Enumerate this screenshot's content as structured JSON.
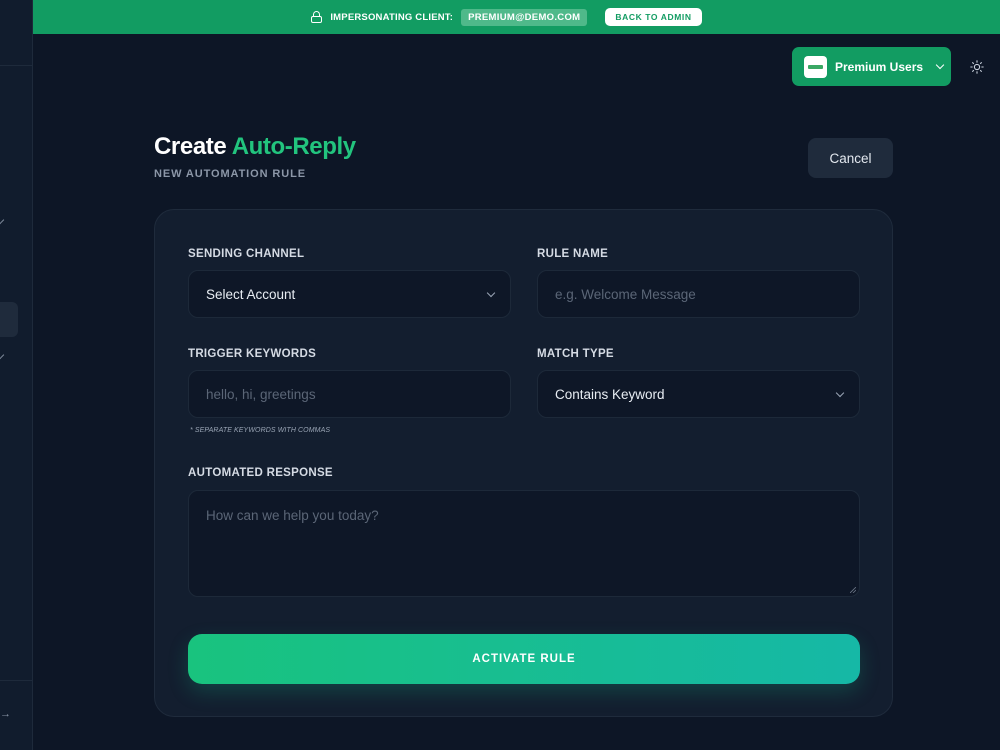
{
  "banner": {
    "label": "IMPERSONATING CLIENT:",
    "email": "PREMIUM@DEMO.COM",
    "back_label": "BACK TO ADMIN"
  },
  "account": {
    "name": "Premium Users",
    "logo": "brand-logo-icon"
  },
  "header": {
    "title_part1": "Create",
    "title_part2": "Auto-Reply",
    "subtitle": "NEW AUTOMATION RULE",
    "cancel_label": "Cancel"
  },
  "form": {
    "channel": {
      "label": "SENDING CHANNEL",
      "value": "Select Account"
    },
    "rule_name": {
      "label": "RULE NAME",
      "placeholder": "e.g. Welcome Message"
    },
    "keywords": {
      "label": "TRIGGER KEYWORDS",
      "placeholder": "hello, hi, greetings",
      "hint": "* SEPARATE KEYWORDS WITH COMMAS"
    },
    "match_type": {
      "label": "MATCH TYPE",
      "value": "Contains Keyword"
    },
    "response": {
      "label": "AUTOMATED RESPONSE",
      "placeholder": "How can we help you today?"
    },
    "submit_label": "ACTIVATE RULE"
  },
  "colors": {
    "brand": "#129c62",
    "accent": "#22c47e",
    "background": "#0d1626",
    "card": "#131e2f"
  },
  "icons": [
    "lock-icon",
    "chevron-down-icon",
    "sun-icon",
    "logout-arrow-icon"
  ]
}
